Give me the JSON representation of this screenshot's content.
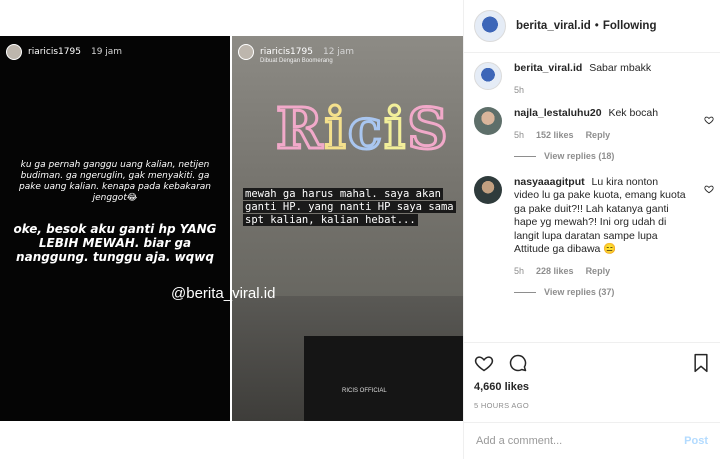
{
  "story_left": {
    "username": "riaricis1795",
    "time": "19 jam",
    "text_small": "ku ga pernah ganggu uang kalian, netijen budiman. ga ngeruglin, gak menyakiti. ga pake uang kalian. kenapa pada kebakaran jenggot😂",
    "text_big": "oke, besok aku ganti hp YANG LEBIH MEWAH. biar ga nanggung. tunggu aja. wqwq",
    "watermark": "@berita_viral.id"
  },
  "story_right": {
    "username": "riaricis1795",
    "time": "12 jam",
    "subtitle": "Dibuat Dengan Boomerang",
    "neon_text": "RiciS",
    "caption": "mewah ga harus mahal. saya akan ganti HP. yang nanti HP saya sama spt kalian, kalian hebat...",
    "badge": "RICIS OFFICIAL"
  },
  "header": {
    "username": "berita_viral.id",
    "separator": "•",
    "follow_label": "Following"
  },
  "caption": {
    "username": "berita_viral.id",
    "text": "Sabar mbakk",
    "time": "5h"
  },
  "comments": [
    {
      "username": "najla_lestaluhu20",
      "text": "Kek bocah",
      "time": "5h",
      "likes": "152 likes",
      "reply_label": "Reply",
      "view_replies": "View replies (18)"
    },
    {
      "username": "nasyaaagitput",
      "text": "Lu kira nonton video lu ga pake kuota, emang kuota ga pake duit?!! Lah katanya ganti hape yg mewah?! Ini org udah di langit lupa daratan sampe lupa Attitude ga dibawa 😑",
      "time": "5h",
      "likes": "228 likes",
      "reply_label": "Reply",
      "view_replies": "View replies (37)"
    }
  ],
  "actions": {
    "likes": "4,660 likes",
    "time_ago": "5 HOURS AGO"
  },
  "add_comment": {
    "placeholder": "Add a comment...",
    "post_label": "Post"
  },
  "colors": {
    "text": "#262626",
    "muted": "#8e8e8e",
    "post_disabled": "#b3dbff",
    "border": "#efefef"
  }
}
